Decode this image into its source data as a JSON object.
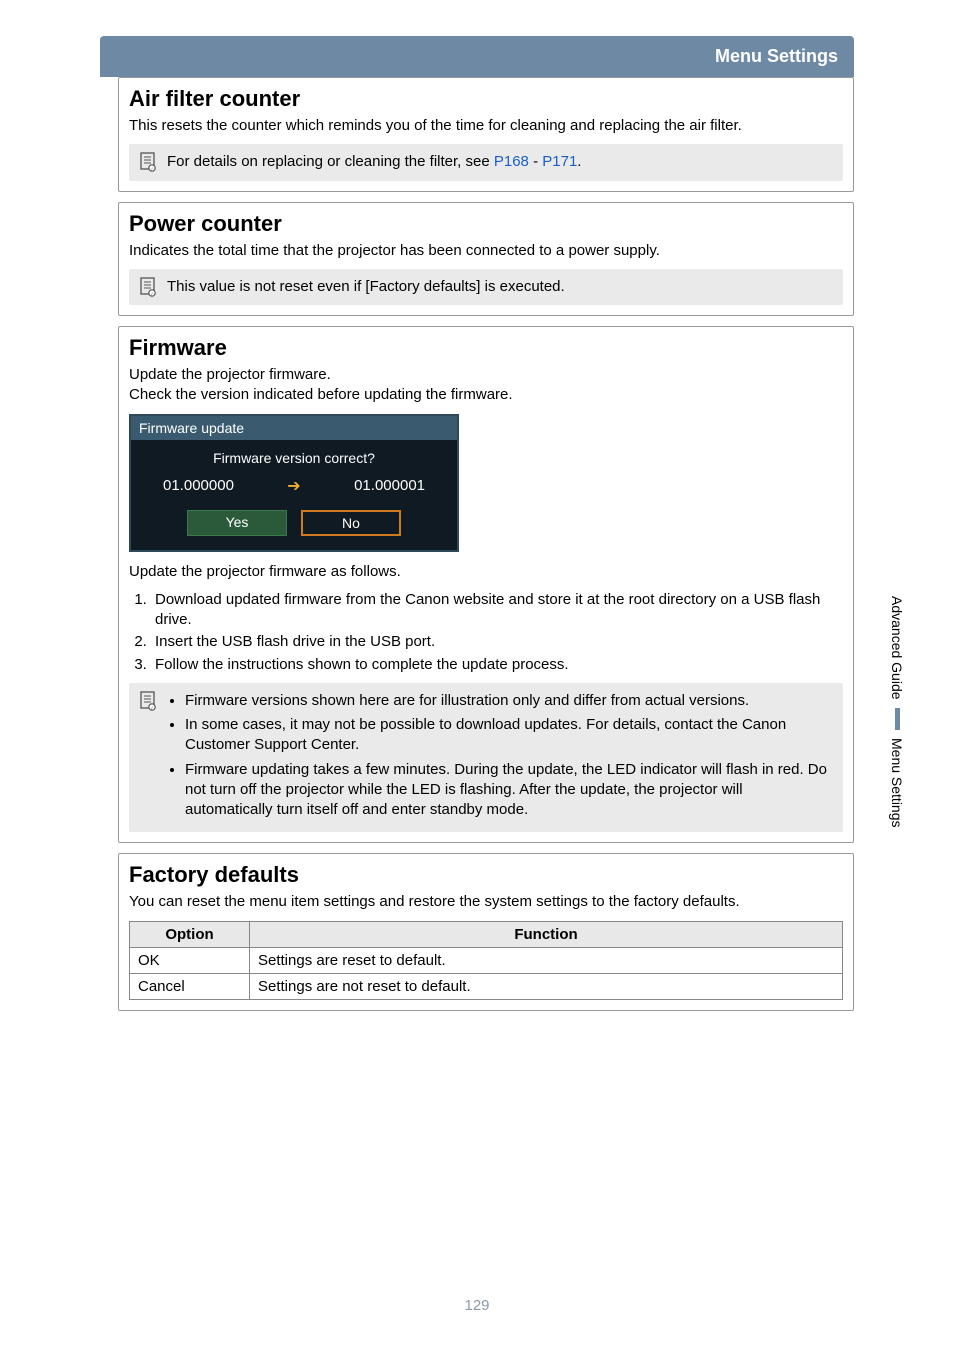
{
  "header": {
    "title": "Menu Settings"
  },
  "page_number": "129",
  "side_tabs": {
    "advanced": "Advanced Guide",
    "menu": "Menu Settings"
  },
  "air_filter": {
    "heading": "Air filter counter",
    "desc": "This resets the counter which reminds you of the time for cleaning and replacing the air filter.",
    "note_prefix": "For details on replacing or cleaning the filter, see ",
    "link1": "P168",
    "sep": " - ",
    "link2": "P171",
    "note_suffix": "."
  },
  "power_counter": {
    "heading": "Power counter",
    "desc": "Indicates the total time that the projector has been connected to a power supply.",
    "note": "This value is not reset even if [Factory defaults] is executed."
  },
  "firmware": {
    "heading": "Firmware",
    "desc1": "Update the projector firmware.",
    "desc2": "Check the version indicated before updating the firmware.",
    "dialog": {
      "title": "Firmware update",
      "question": "Firmware version correct?",
      "from": "01.000000",
      "to": "01.000001",
      "yes": "Yes",
      "no": "No"
    },
    "steps_intro": "Update the projector firmware as follows.",
    "steps": [
      "Download updated firmware from the Canon website and store it at the root directory on a USB flash drive.",
      "Insert the USB flash drive in the USB port.",
      "Follow the instructions shown to complete the update process."
    ],
    "notes": [
      "Firmware versions shown here are for illustration only and differ from actual versions.",
      "In some cases, it may not be possible to download updates. For details, contact the Canon Customer Support Center.",
      "Firmware updating takes a few minutes. During the update, the LED indicator will flash in red. Do not turn off the projector while the LED is flashing. After the update, the projector will automatically turn itself off and enter standby mode."
    ]
  },
  "factory": {
    "heading": "Factory defaults",
    "desc": "You can reset the menu item settings and restore the system settings to the factory defaults.",
    "th_option": "Option",
    "th_function": "Function",
    "rows": [
      {
        "option": "OK",
        "function": "Settings are reset to default."
      },
      {
        "option": "Cancel",
        "function": "Settings are not reset to default."
      }
    ]
  }
}
